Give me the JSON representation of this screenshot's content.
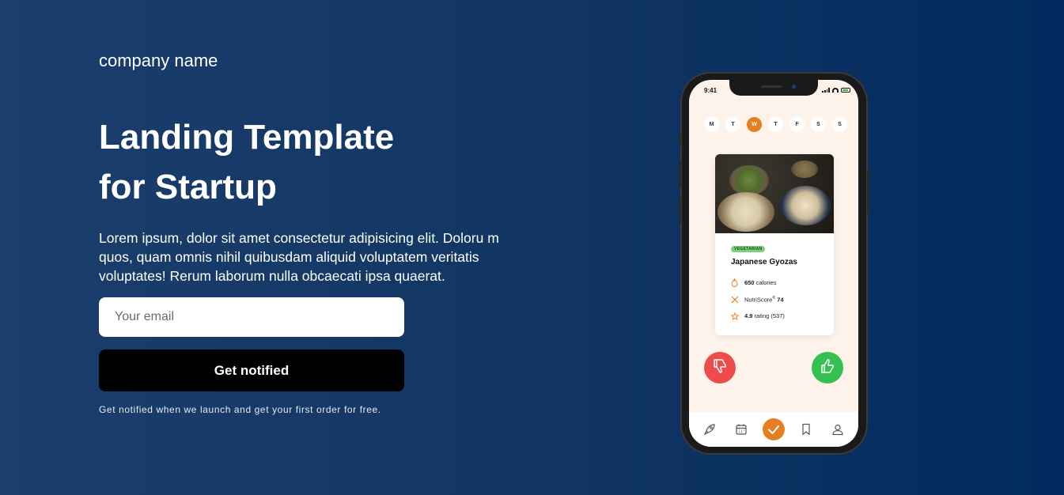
{
  "brand": {
    "name": "company name"
  },
  "hero": {
    "title_line1": "Landing Template",
    "title_line2": "for Startup",
    "description": "Lorem ipsum, dolor sit amet consectetur adipisicing elit. Doloru m quos, quam omnis nihil quibusdam aliquid voluptatem veritatis voluptates! Rerum laborum nulla obcaecati ipsa quaerat."
  },
  "signup": {
    "email_placeholder": "Your email",
    "email_value": "",
    "button_label": "Get notified",
    "note": "Get notified when we launch and get your first order for free."
  },
  "phone": {
    "status_time": "9:41",
    "days": [
      "M",
      "T",
      "W",
      "T",
      "F",
      "S",
      "S"
    ],
    "active_day": "W",
    "card": {
      "tag": "VEGETARIAN",
      "dish": "Japanese Gyozas",
      "calories_value": "650",
      "calories_label": "calories",
      "nutriscore_label": "NutriScore",
      "nutriscore_sup": "®",
      "nutriscore_value": "74",
      "rating_value": "4.9",
      "rating_label": "rating (537)"
    },
    "tabs": [
      "rocket-icon",
      "calendar-icon",
      "check-icon",
      "bookmark-icon",
      "user-icon"
    ],
    "active_tab": "check-icon"
  },
  "colors": {
    "background_start": "#1b3e6d",
    "background_end": "#012a5e",
    "accent": "#e67e22",
    "dislike": "#ee4c4c",
    "like": "#35c051",
    "button": "#000000"
  }
}
